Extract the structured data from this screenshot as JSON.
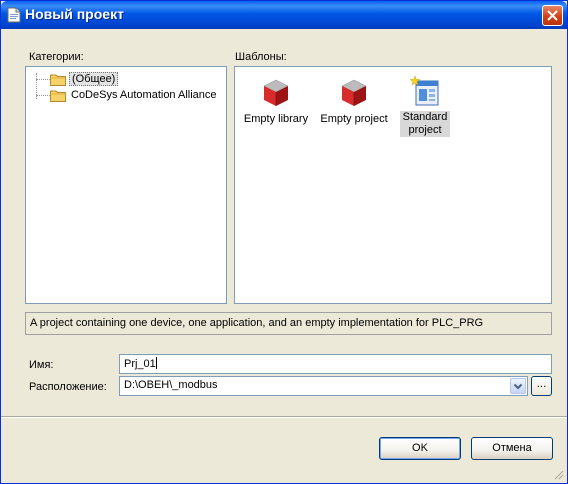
{
  "window": {
    "title": "Новый проект"
  },
  "categories": {
    "label": "Категории:",
    "items": [
      {
        "label": "(Общее)",
        "selected": true
      },
      {
        "label": "CoDeSys Automation Alliance",
        "selected": false
      }
    ]
  },
  "templates": {
    "label": "Шаблоны:",
    "items": [
      {
        "label": "Empty library",
        "icon": "cube-icon"
      },
      {
        "label": "Empty project",
        "icon": "cube-icon"
      },
      {
        "label": "Standard project",
        "icon": "standard-project-icon",
        "selected": true
      }
    ]
  },
  "description": "A project containing one device, one application, and an empty implementation for PLC_PRG",
  "form": {
    "name_label": "Имя:",
    "name_value": "Prj_01",
    "location_label": "Расположение:",
    "location_value": "D:\\ОВЕН\\_modbus",
    "browse_label": "..."
  },
  "buttons": {
    "ok": "OK",
    "cancel": "Отмена"
  },
  "colors": {
    "titlebar": "#0054e3",
    "panel_border": "#7f9db9",
    "dialog_bg": "#ece9d8",
    "close": "#d34216",
    "cube": "#c8202a"
  }
}
